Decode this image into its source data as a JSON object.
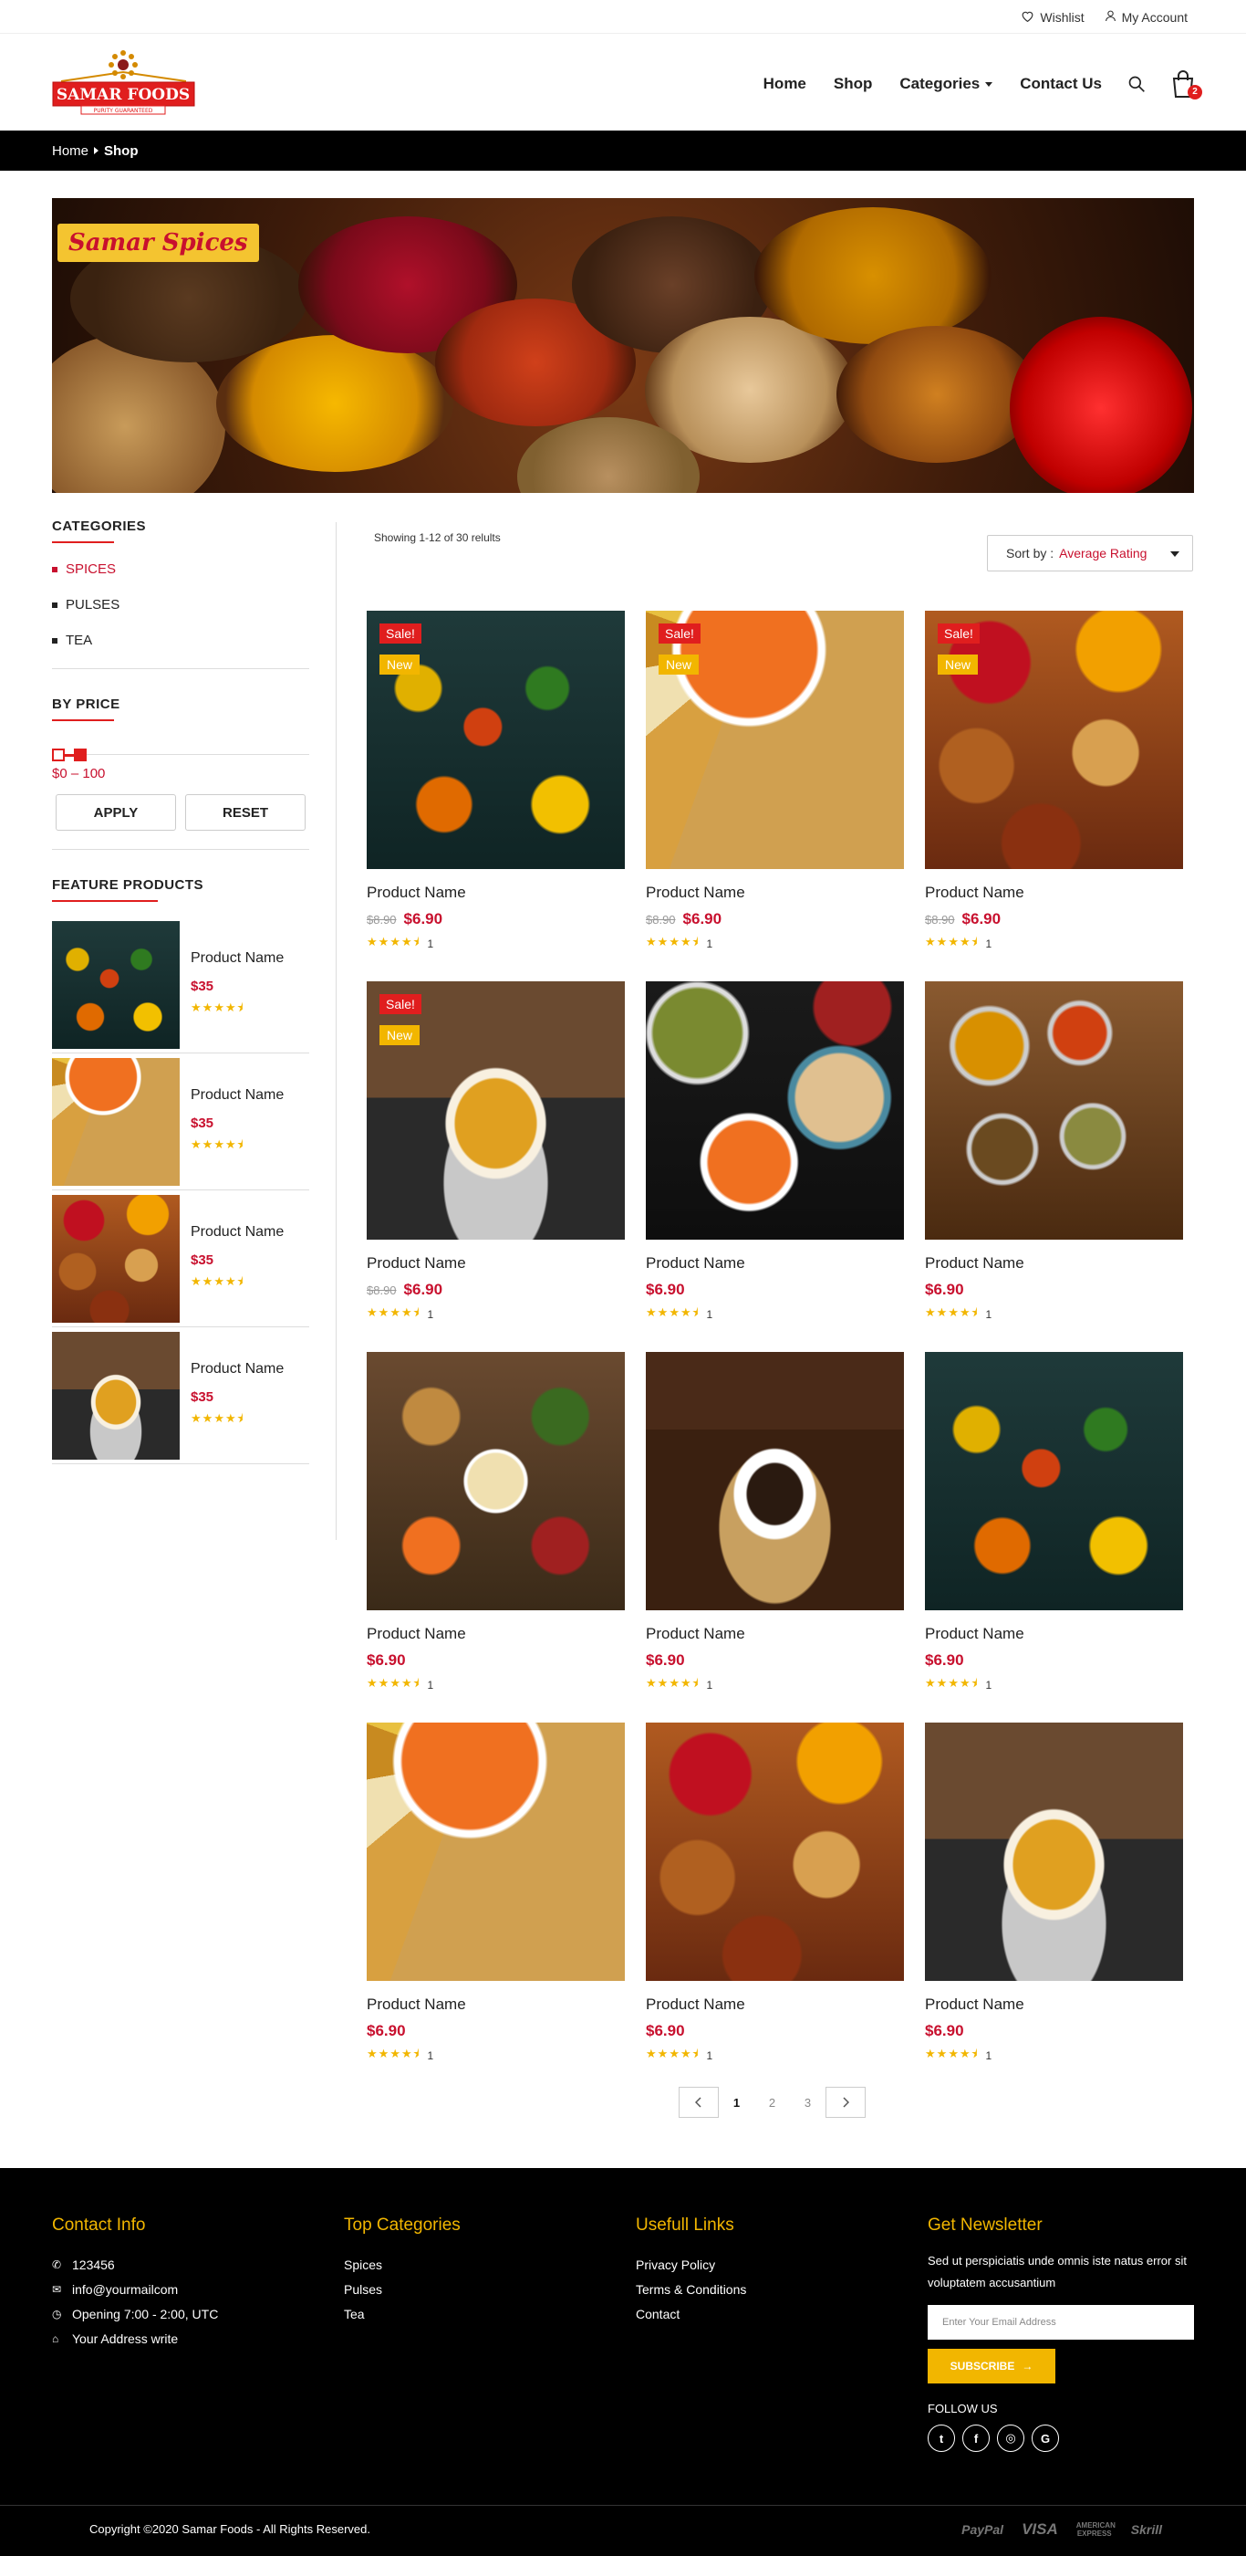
{
  "topbar": {
    "wishlist": "Wishlist",
    "account": "My Account"
  },
  "brand": {
    "name": "SAMAR FOODS",
    "tagline": "PURITY GUARANTEED",
    "red": "#e01e1e",
    "gold": "#f2b600"
  },
  "nav": {
    "home": "Home",
    "shop": "Shop",
    "categories": "Categories",
    "contact": "Contact Us",
    "cart_count": "2"
  },
  "breadcrumb": {
    "home": "Home",
    "current": "Shop"
  },
  "banner": {
    "badge": "Samar Spices"
  },
  "sidebar": {
    "categories_title": "CATEGORIES",
    "categories": [
      "SPICES",
      "PULSES",
      "TEA"
    ],
    "active_category": "SPICES",
    "price_title": "BY PRICE",
    "price_range": "$0 – 100",
    "apply": "APPLY",
    "reset": "RESET",
    "feature_title": "FEATURE PRODUCTS",
    "featured": [
      {
        "name": "Product Name",
        "price": "$35",
        "image": "spice-spoons",
        "rating": 4.5
      },
      {
        "name": "Product Name",
        "price": "$35",
        "image": "lentil-platter",
        "rating": 4.5
      },
      {
        "name": "Product Name",
        "price": "$35",
        "image": "spice-sacks",
        "rating": 4.5
      },
      {
        "name": "Product Name",
        "price": "$35",
        "image": "tea-cup",
        "rating": 4.5
      }
    ]
  },
  "listing": {
    "showing": "Showing 1-12 of 30 relults",
    "sort_label": "Sort by :",
    "sort_value": "Average Rating"
  },
  "products": [
    {
      "name": "Product Name",
      "old_price": "$8.90",
      "price": "$6.90",
      "sale": "Sale!",
      "new": "New",
      "rating_count": "1",
      "image": "spice-spoons"
    },
    {
      "name": "Product Name",
      "old_price": "$8.90",
      "price": "$6.90",
      "sale": "Sale!",
      "new": "New",
      "rating_count": "1",
      "image": "lentil-platter"
    },
    {
      "name": "Product Name",
      "old_price": "$8.90",
      "price": "$6.90",
      "sale": "Sale!",
      "new": "New",
      "rating_count": "1",
      "image": "spice-sacks"
    },
    {
      "name": "Product Name",
      "old_price": "$8.90",
      "price": "$6.90",
      "sale": "Sale!",
      "new": "New",
      "rating_count": "1",
      "image": "tea-cup"
    },
    {
      "name": "Product Name",
      "old_price": "",
      "price": "$6.90",
      "sale": "",
      "new": "",
      "rating_count": "1",
      "image": "beans-bowls"
    },
    {
      "name": "Product Name",
      "old_price": "",
      "price": "$6.90",
      "sale": "",
      "new": "",
      "rating_count": "1",
      "image": "spice-jars"
    },
    {
      "name": "Product Name",
      "old_price": "",
      "price": "$6.90",
      "sale": "",
      "new": "",
      "rating_count": "1",
      "image": "grain-bowls"
    },
    {
      "name": "Product Name",
      "old_price": "",
      "price": "$6.90",
      "sale": "",
      "new": "",
      "rating_count": "1",
      "image": "coffee-cup"
    },
    {
      "name": "Product Name",
      "old_price": "",
      "price": "$6.90",
      "sale": "",
      "new": "",
      "rating_count": "1",
      "image": "spice-spoons"
    },
    {
      "name": "Product Name",
      "old_price": "",
      "price": "$6.90",
      "sale": "",
      "new": "",
      "rating_count": "1",
      "image": "lentil-platter"
    },
    {
      "name": "Product Name",
      "old_price": "",
      "price": "$6.90",
      "sale": "",
      "new": "",
      "rating_count": "1",
      "image": "spice-sacks"
    },
    {
      "name": "Product Name",
      "old_price": "",
      "price": "$6.90",
      "sale": "",
      "new": "",
      "rating_count": "1",
      "image": "tea-cup"
    }
  ],
  "pagination": {
    "pages": [
      "1",
      "2",
      "3"
    ],
    "current": "1"
  },
  "footer": {
    "contact_title": "Contact Info",
    "phone": "123456",
    "email": "info@yourmailcom",
    "hours": "Opening 7:00 - 2:00, UTC",
    "address": "Your Address write",
    "categories_title": "Top Categories",
    "categories": [
      "Spices",
      "Pulses",
      "Tea"
    ],
    "links_title": "Usefull Links",
    "links": [
      "Privacy Policy",
      "Terms & Conditions",
      "Contact"
    ],
    "newsletter_title": "Get Newsletter",
    "newsletter_text": "Sed ut perspiciatis unde omnis iste natus error sit voluptatem accusantium",
    "email_placeholder": "Enter Your Email Address",
    "subscribe": "SUBSCRIBE",
    "follow": "FOLLOW US",
    "copyright": "Copyright ©2020 Samar Foods - All Rights Reserved.",
    "payments": [
      "PayPal",
      "VISA",
      "AMERICAN EXPRESS",
      "Skrill"
    ]
  }
}
